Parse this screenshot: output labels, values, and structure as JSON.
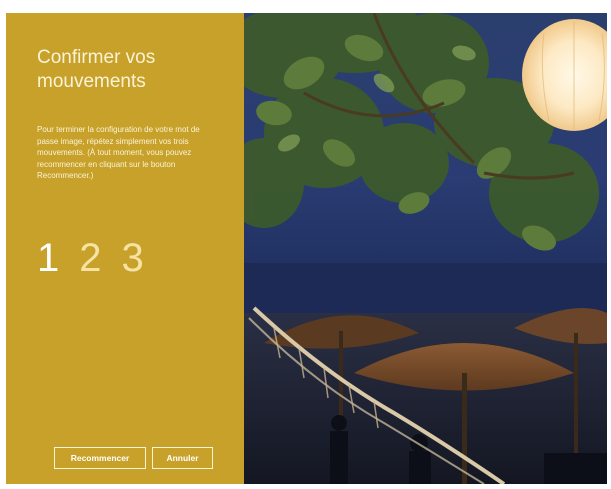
{
  "panel": {
    "title": "Confirmer vos mouvements",
    "description": "Pour terminer la configuration de votre mot de passe image, répétez simplement vos trois mouvements. (À tout moment, vous pouvez recommencer en cliquant sur le bouton Recommencer.)",
    "steps": [
      {
        "label": "1",
        "state": "done"
      },
      {
        "label": "2",
        "state": "pending"
      },
      {
        "label": "3",
        "state": "pending"
      }
    ]
  },
  "buttons": {
    "restart_label": "Recommencer",
    "cancel_label": "Annuler"
  },
  "colors": {
    "panel_accent": "#c7a12a",
    "panel_text": "#fbf3d6"
  }
}
